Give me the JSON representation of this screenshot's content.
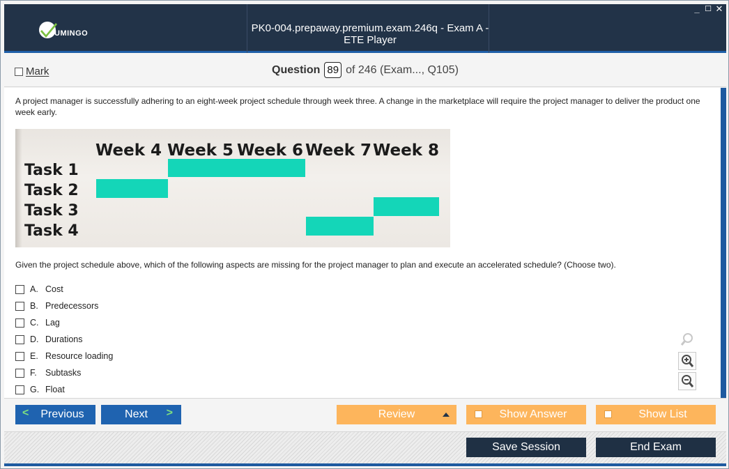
{
  "titlebar": {
    "logo_text": "UMINGO",
    "title": "PK0-004.prepaway.premium.exam.246q - Exam A - ETE Player",
    "controls": {
      "minimize": "_",
      "maximize": "☐",
      "close": "✕"
    }
  },
  "question_header": {
    "mark_label": "Mark",
    "question_label": "Question",
    "question_number": "89",
    "of_text": "of 246 (Exam..., Q105)"
  },
  "question": {
    "text": "A project manager is successfully adhering to an eight-week project schedule through week three. A change in the marketplace will require the project manager to deliver the product one week early.",
    "exhibit": {
      "weeks": [
        "Week 4",
        "Week 5",
        "Week 6",
        "Week 7",
        "Week 8"
      ],
      "tasks": [
        "Task 1",
        "Task 2",
        "Task 3",
        "Task 4"
      ],
      "bar_color": "#14d6b8"
    },
    "prompt": "Given the project schedule above, which of the following aspects are missing for the project manager to plan and execute an accelerated schedule? (Choose two).",
    "answers": [
      {
        "letter": "A.",
        "text": "Cost"
      },
      {
        "letter": "B.",
        "text": "Predecessors"
      },
      {
        "letter": "C.",
        "text": "Lag"
      },
      {
        "letter": "D.",
        "text": "Durations"
      },
      {
        "letter": "E.",
        "text": "Resource loading"
      },
      {
        "letter": "F.",
        "text": "Subtasks"
      },
      {
        "letter": "G.",
        "text": "Float"
      }
    ]
  },
  "navigation": {
    "previous_label": "Previous",
    "next_label": "Next",
    "review_label": "Review",
    "show_answer_label": "Show Answer",
    "show_list_label": "Show List"
  },
  "footer": {
    "save_session_label": "Save Session",
    "end_exam_label": "End Exam"
  },
  "colors": {
    "titlebar_bg": "#223348",
    "accent_blue": "#1f63b0",
    "accent_orange": "#fdb55c",
    "dark_button": "#1f3044"
  }
}
